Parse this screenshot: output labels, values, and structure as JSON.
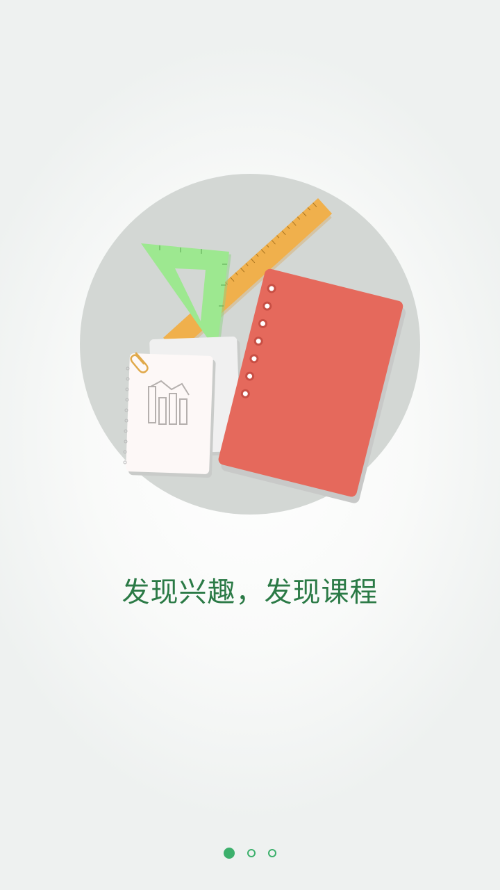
{
  "onboarding": {
    "slogan": "发现兴趣，发现课程",
    "illustration_icon": "stationery-illustration-icon",
    "page_indicator": {
      "total": 3,
      "active_index": 0
    }
  },
  "colors": {
    "slogan": "#2b7a46",
    "indicator": "#3cb06c",
    "circle": "#d3d7d4",
    "notebook": "#e5695c",
    "ruler": "#f0b04c",
    "set_square": "#9de890"
  }
}
